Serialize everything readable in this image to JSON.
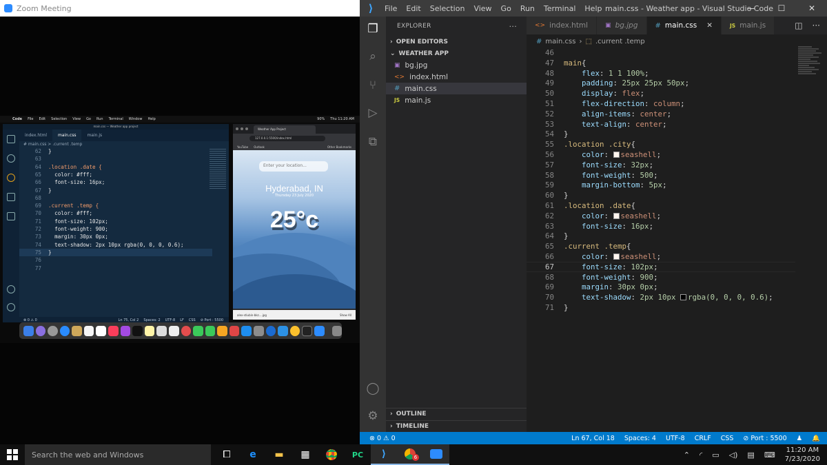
{
  "zoom": {
    "title": "Zoom Meeting",
    "mac_menubar": {
      "items": [
        "Code",
        "File",
        "Edit",
        "Selection",
        "View",
        "Go",
        "Run",
        "Terminal",
        "Window",
        "Help"
      ],
      "window_title": "main.css — Weather app project",
      "status": [
        "90%",
        "Thu 11:20 AM"
      ]
    },
    "mini_vscode": {
      "tabs": [
        "index.html",
        "main.css",
        "main.js"
      ],
      "breadcrumb": "# main.css > .current .temp",
      "lines": [
        {
          "n": "62",
          "t": "}"
        },
        {
          "n": "63",
          "t": ""
        },
        {
          "n": "64",
          "t": ".location .date {"
        },
        {
          "n": "65",
          "t": "  color: #fff;"
        },
        {
          "n": "66",
          "t": "  font-size: 16px;"
        },
        {
          "n": "67",
          "t": "}"
        },
        {
          "n": "68",
          "t": ""
        },
        {
          "n": "69",
          "t": ".current .temp {"
        },
        {
          "n": "70",
          "t": "  color: #fff;"
        },
        {
          "n": "71",
          "t": "  font-size: 102px;"
        },
        {
          "n": "72",
          "t": "  font-weight: 900;"
        },
        {
          "n": "73",
          "t": "  margin: 30px 0px;"
        },
        {
          "n": "74",
          "t": "  text-shadow: 2px 10px rgba(0, 0, 0, 0.6);"
        },
        {
          "n": "75",
          "t": "}"
        },
        {
          "n": "76",
          "t": ""
        },
        {
          "n": "77",
          "t": ""
        }
      ],
      "status": {
        "left": "⊗ 0 ⚠ 0",
        "right": [
          "Ln 75, Col 2",
          "Spaces: 2",
          "UTF-8",
          "LF",
          "CSS",
          "⊘ Port : 5500"
        ]
      }
    },
    "mini_browser": {
      "tab_title": "Weather App Project",
      "url": "127.0.0.1:5500/index.html",
      "bookmarks": [
        "YouTube",
        "Outlook",
        "Other Bookmarks"
      ],
      "search_placeholder": "Enter your location...",
      "city": "Hyderabad, IN",
      "date": "Thursday 23 July 2020",
      "temp": "25°c",
      "download": "alex-stiubin-bkz....jpg",
      "show_all": "Show All"
    }
  },
  "vscode": {
    "menu": [
      "File",
      "Edit",
      "Selection",
      "View",
      "Go",
      "Run",
      "Terminal",
      "Help"
    ],
    "window_title": "main.css - Weather app - Visual Studio Code",
    "window_buttons": [
      "—",
      "☐",
      "✕"
    ],
    "explorer_title": "EXPLORER",
    "sections": {
      "open_editors": "OPEN EDITORS",
      "project": "WEATHER APP",
      "outline": "OUTLINE",
      "timeline": "TIMELINE"
    },
    "files": [
      {
        "name": "bg.jpg",
        "icon": "image-icon"
      },
      {
        "name": "index.html",
        "icon": "html-icon"
      },
      {
        "name": "main.css",
        "icon": "css-icon",
        "selected": true
      },
      {
        "name": "main.js",
        "icon": "js-icon"
      }
    ],
    "tabs": [
      {
        "label": "index.html",
        "icon": "<>"
      },
      {
        "label": "bg.jpg",
        "icon": "▣"
      },
      {
        "label": "main.css",
        "icon": "#",
        "active": true
      },
      {
        "label": "main.js",
        "icon": "JS"
      }
    ],
    "breadcrumb": {
      "file": "main.css",
      "symbol": ".current .temp"
    },
    "code": [
      {
        "n": "46",
        "parts": []
      },
      {
        "n": "47",
        "parts": [
          [
            "sel-c",
            "main"
          ],
          [
            "pun",
            "{"
          ]
        ]
      },
      {
        "n": "48",
        "parts": [
          [
            "pun",
            "    "
          ],
          [
            "prop",
            "flex"
          ],
          [
            "pun",
            ": "
          ],
          [
            "num",
            "1 1 100%"
          ],
          [
            "pun",
            ";"
          ]
        ]
      },
      {
        "n": "49",
        "parts": [
          [
            "pun",
            "    "
          ],
          [
            "prop",
            "padding"
          ],
          [
            "pun",
            ": "
          ],
          [
            "num",
            "25px 25px 50px"
          ],
          [
            "pun",
            ";"
          ]
        ]
      },
      {
        "n": "50",
        "parts": [
          [
            "pun",
            "    "
          ],
          [
            "prop",
            "display"
          ],
          [
            "pun",
            ": "
          ],
          [
            "val",
            "flex"
          ],
          [
            "pun",
            ";"
          ]
        ]
      },
      {
        "n": "51",
        "parts": [
          [
            "pun",
            "    "
          ],
          [
            "prop",
            "flex-direction"
          ],
          [
            "pun",
            ": "
          ],
          [
            "val",
            "column"
          ],
          [
            "pun",
            ";"
          ]
        ]
      },
      {
        "n": "52",
        "parts": [
          [
            "pun",
            "    "
          ],
          [
            "prop",
            "align-items"
          ],
          [
            "pun",
            ": "
          ],
          [
            "val",
            "center"
          ],
          [
            "pun",
            ";"
          ]
        ]
      },
      {
        "n": "53",
        "parts": [
          [
            "pun",
            "    "
          ],
          [
            "prop",
            "text-align"
          ],
          [
            "pun",
            ": "
          ],
          [
            "val",
            "center"
          ],
          [
            "pun",
            ";"
          ]
        ]
      },
      {
        "n": "54",
        "parts": [
          [
            "pun",
            "}"
          ]
        ]
      },
      {
        "n": "55",
        "parts": [
          [
            "sel-c",
            ".location .city"
          ],
          [
            "pun",
            "{"
          ]
        ]
      },
      {
        "n": "56",
        "parts": [
          [
            "pun",
            "    "
          ],
          [
            "prop",
            "color"
          ],
          [
            "pun",
            ": "
          ],
          [
            "swatch",
            "#fff5ee"
          ],
          [
            "val",
            "seashell"
          ],
          [
            "pun",
            ";"
          ]
        ]
      },
      {
        "n": "57",
        "parts": [
          [
            "pun",
            "    "
          ],
          [
            "prop",
            "font-size"
          ],
          [
            "pun",
            ": "
          ],
          [
            "num",
            "32px"
          ],
          [
            "pun",
            ";"
          ]
        ]
      },
      {
        "n": "58",
        "parts": [
          [
            "pun",
            "    "
          ],
          [
            "prop",
            "font-weight"
          ],
          [
            "pun",
            ": "
          ],
          [
            "num",
            "500"
          ],
          [
            "pun",
            ";"
          ]
        ]
      },
      {
        "n": "59",
        "parts": [
          [
            "pun",
            "    "
          ],
          [
            "prop",
            "margin-bottom"
          ],
          [
            "pun",
            ": "
          ],
          [
            "num",
            "5px"
          ],
          [
            "pun",
            ";"
          ]
        ]
      },
      {
        "n": "60",
        "parts": [
          [
            "pun",
            "}"
          ]
        ]
      },
      {
        "n": "61",
        "parts": [
          [
            "sel-c",
            ".location .date"
          ],
          [
            "pun",
            "{"
          ]
        ]
      },
      {
        "n": "62",
        "parts": [
          [
            "pun",
            "    "
          ],
          [
            "prop",
            "color"
          ],
          [
            "pun",
            ": "
          ],
          [
            "swatch",
            "#fff5ee"
          ],
          [
            "val",
            "seashell"
          ],
          [
            "pun",
            ";"
          ]
        ]
      },
      {
        "n": "63",
        "parts": [
          [
            "pun",
            "    "
          ],
          [
            "prop",
            "font-size"
          ],
          [
            "pun",
            ": "
          ],
          [
            "num",
            "16px"
          ],
          [
            "pun",
            ";"
          ]
        ]
      },
      {
        "n": "64",
        "parts": [
          [
            "pun",
            "}"
          ]
        ]
      },
      {
        "n": "65",
        "parts": [
          [
            "sel-c",
            ".current .temp"
          ],
          [
            "pun",
            "{"
          ]
        ]
      },
      {
        "n": "66",
        "parts": [
          [
            "pun",
            "    "
          ],
          [
            "prop",
            "color"
          ],
          [
            "pun",
            ": "
          ],
          [
            "swatch",
            "#fff5ee"
          ],
          [
            "val",
            "seashell"
          ],
          [
            "pun",
            ";"
          ]
        ]
      },
      {
        "n": "67",
        "parts": [
          [
            "pun",
            "    "
          ],
          [
            "prop",
            "font-size"
          ],
          [
            "pun",
            ": "
          ],
          [
            "num",
            "102px"
          ],
          [
            "pun",
            ";"
          ]
        ]
      },
      {
        "n": "68",
        "parts": [
          [
            "pun",
            "    "
          ],
          [
            "prop",
            "font-weight"
          ],
          [
            "pun",
            ": "
          ],
          [
            "num",
            "900"
          ],
          [
            "pun",
            ";"
          ]
        ]
      },
      {
        "n": "69",
        "parts": [
          [
            "pun",
            "    "
          ],
          [
            "prop",
            "margin"
          ],
          [
            "pun",
            ": "
          ],
          [
            "num",
            "30px 0px"
          ],
          [
            "pun",
            ";"
          ]
        ]
      },
      {
        "n": "70",
        "parts": [
          [
            "pun",
            "    "
          ],
          [
            "prop",
            "text-shadow"
          ],
          [
            "pun",
            ": "
          ],
          [
            "num",
            "2px 10px "
          ],
          [
            "swatch",
            "#000000"
          ],
          [
            "num",
            "rgba(0, 0, 0, 0.6)"
          ],
          [
            "pun",
            ";"
          ]
        ]
      },
      {
        "n": "71",
        "parts": [
          [
            "pun",
            "}"
          ]
        ]
      }
    ],
    "status": {
      "problems": "⊗ 0 ⚠ 0",
      "right": [
        "Ln 67, Col 18",
        "Spaces: 4",
        "UTF-8",
        "CRLF",
        "CSS",
        "⊘ Port : 5500",
        "♟",
        "🔔"
      ]
    }
  },
  "taskbar": {
    "search_placeholder": "Search the web and Windows",
    "time": "11:20 AM",
    "date": "7/23/2020",
    "chrome_badge": "6"
  }
}
